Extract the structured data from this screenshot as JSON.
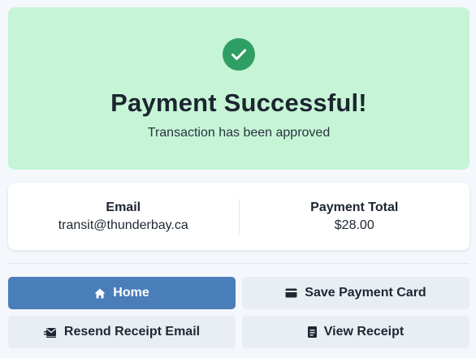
{
  "banner": {
    "title": "Payment Successful!",
    "subtitle": "Transaction has been approved",
    "icon": "check-circle-icon",
    "color": "#c6f5d6",
    "icon_color": "#2f9e63"
  },
  "details": {
    "email_label": "Email",
    "email_value": "transit@thunderbay.ca",
    "total_label": "Payment Total",
    "total_value": "$28.00"
  },
  "actions": {
    "home": {
      "label": "Home",
      "icon": "home-icon",
      "color": "#4a7eb9"
    },
    "save_card": {
      "label": "Save Payment Card",
      "icon": "credit-card-icon"
    },
    "resend": {
      "label": "Resend Receipt Email",
      "icon": "mail-send-icon"
    },
    "view_receipt": {
      "label": "View Receipt",
      "icon": "receipt-icon"
    }
  }
}
